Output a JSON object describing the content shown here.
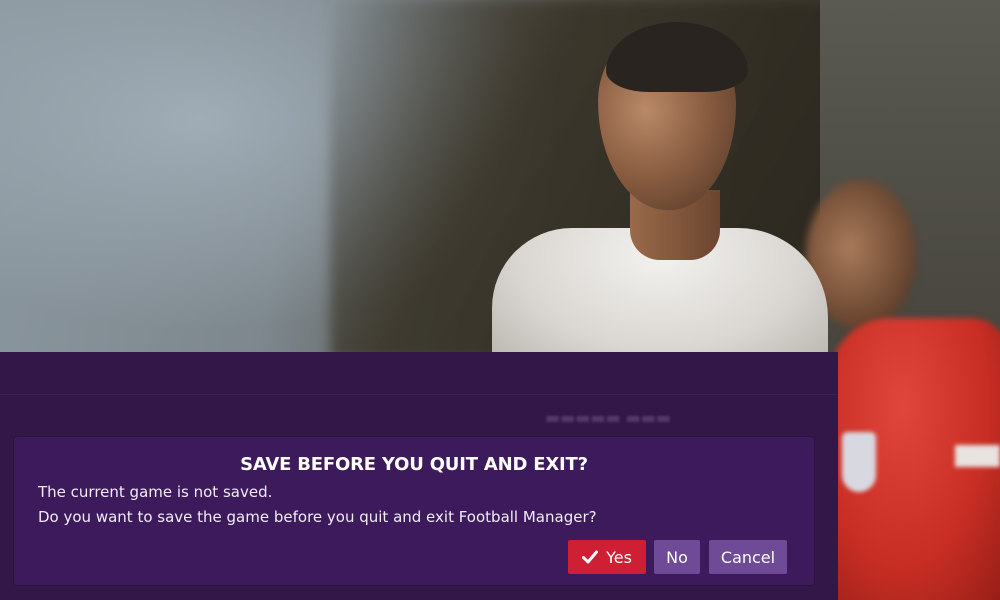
{
  "dialog": {
    "title": "SAVE BEFORE YOU QUIT AND EXIT?",
    "line1": "The current game is not saved.",
    "line2": "Do you want to save the game before you quit and exit Football Manager?",
    "buttons": {
      "yes": "Yes",
      "no": "No",
      "cancel": "Cancel"
    }
  },
  "colors": {
    "panel": "#331749",
    "dialog": "#3d1a5b",
    "yes_button": "#cf1f35",
    "secondary_button": "#6e4a97"
  },
  "icons": {
    "yes": "check-icon"
  }
}
